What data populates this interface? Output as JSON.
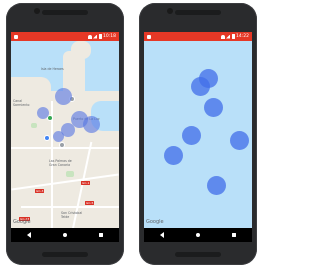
{
  "colors": {
    "status_bar": "#e53826",
    "water": "#b9e0f9",
    "marker_blue": "#426ee8",
    "phone_body": "#2a2b2d"
  },
  "left_phone": {
    "status_time": "10:18",
    "map_labels": {
      "top_label": "Isla de Heroes",
      "left_label_1": "Canal",
      "left_label_2": "Sarmiento",
      "mid_label": "Puerto de La Luz",
      "lower_label": "Las Palmas de",
      "lower_label_2": "Gran Canaria",
      "bottom_label_1": "San Cristobal",
      "bottom_label_2": "Telde"
    },
    "highway_labels": [
      "GC-1",
      "GC-3",
      "GC-5",
      "GC-23"
    ],
    "brand": "Google",
    "marker_count": 6
  },
  "right_phone": {
    "status_time": "14:22",
    "brand": "Google",
    "marker_count": 8
  },
  "icons": [
    "back-icon",
    "home-icon",
    "recents-icon",
    "wifi-icon",
    "signal-icon",
    "battery-icon"
  ]
}
